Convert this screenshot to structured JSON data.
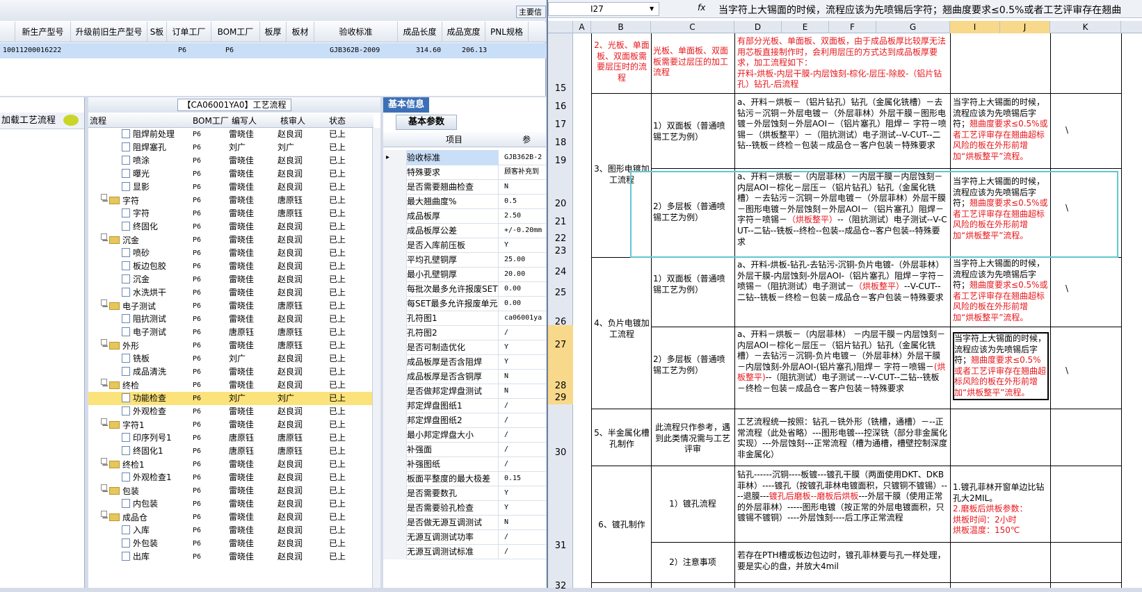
{
  "top_grid": {
    "main_button": "主要信",
    "headers": [
      "",
      "新生产型号",
      "升级前旧生产型号",
      "S板",
      "订单工厂",
      "BOM工厂",
      "板厚",
      "板材",
      "验收标准",
      "成品长度",
      "成品宽度",
      "PNL规格"
    ],
    "row": [
      "10011200016222",
      "",
      "P6",
      "P6",
      "",
      "",
      "GJB362B-2009",
      "314.60",
      "206.13",
      ""
    ]
  },
  "left_panel": {
    "label": "加载工艺流程"
  },
  "tree_panel": {
    "title": "【CA06001YA0】工艺流程",
    "headers": [
      "流程",
      "BOM工厂",
      "编写人",
      "核审人",
      "状态"
    ],
    "rows": [
      {
        "type": "item",
        "name": "阻焊前处理",
        "bom": "P6",
        "writer": "雷晓佳",
        "reviewer": "赵良润",
        "status": "已上"
      },
      {
        "type": "item",
        "name": "阻焊塞孔",
        "bom": "P6",
        "writer": "刘广",
        "reviewer": "刘广",
        "status": "已上"
      },
      {
        "type": "item",
        "name": "喷涂",
        "bom": "P6",
        "writer": "雷晓佳",
        "reviewer": "赵良润",
        "status": "已上"
      },
      {
        "type": "item",
        "name": "曝光",
        "bom": "P6",
        "writer": "雷晓佳",
        "reviewer": "赵良润",
        "status": "已上"
      },
      {
        "type": "item",
        "name": "显影",
        "bom": "P6",
        "writer": "雷晓佳",
        "reviewer": "赵良润",
        "status": "已上"
      },
      {
        "type": "folder",
        "name": "字符",
        "bom": "P6",
        "writer": "雷晓佳",
        "reviewer": "唐原钰",
        "status": "已上"
      },
      {
        "type": "item",
        "name": "字符",
        "bom": "P6",
        "writer": "雷晓佳",
        "reviewer": "唐原钰",
        "status": "已上"
      },
      {
        "type": "item",
        "name": "终固化",
        "bom": "P6",
        "writer": "雷晓佳",
        "reviewer": "赵良润",
        "status": "已上"
      },
      {
        "type": "folder",
        "name": "沉金",
        "bom": "P6",
        "writer": "雷晓佳",
        "reviewer": "赵良润",
        "status": "已上"
      },
      {
        "type": "item",
        "name": "喷砂",
        "bom": "P6",
        "writer": "雷晓佳",
        "reviewer": "赵良润",
        "status": "已上"
      },
      {
        "type": "item",
        "name": "板边包胶",
        "bom": "P6",
        "writer": "雷晓佳",
        "reviewer": "赵良润",
        "status": "已上"
      },
      {
        "type": "item",
        "name": "沉金",
        "bom": "P6",
        "writer": "雷晓佳",
        "reviewer": "赵良润",
        "status": "已上"
      },
      {
        "type": "item",
        "name": "水洗烘干",
        "bom": "P6",
        "writer": "雷晓佳",
        "reviewer": "赵良润",
        "status": "已上"
      },
      {
        "type": "folder",
        "name": "电子测试",
        "bom": "P6",
        "writer": "雷晓佳",
        "reviewer": "唐原钰",
        "status": "已上"
      },
      {
        "type": "item",
        "name": "阻抗测试",
        "bom": "P6",
        "writer": "雷晓佳",
        "reviewer": "赵良润",
        "status": "已上"
      },
      {
        "type": "item",
        "name": "电子测试",
        "bom": "P6",
        "writer": "唐原钰",
        "reviewer": "唐原钰",
        "status": "已上"
      },
      {
        "type": "folder",
        "name": "外形",
        "bom": "P6",
        "writer": "雷晓佳",
        "reviewer": "唐原钰",
        "status": "已上"
      },
      {
        "type": "item",
        "name": "铣板",
        "bom": "P6",
        "writer": "刘广",
        "reviewer": "赵良润",
        "status": "已上"
      },
      {
        "type": "item",
        "name": "成品清洗",
        "bom": "P6",
        "writer": "雷晓佳",
        "reviewer": "赵良润",
        "status": "已上"
      },
      {
        "type": "folder",
        "name": "终检",
        "bom": "P6",
        "writer": "雷晓佳",
        "reviewer": "赵良润",
        "status": "已上"
      },
      {
        "type": "item",
        "name": "功能检查",
        "bom": "P6",
        "writer": "刘广",
        "reviewer": "刘广",
        "status": "已上",
        "selected": true
      },
      {
        "type": "item",
        "name": "外观检查",
        "bom": "P6",
        "writer": "雷晓佳",
        "reviewer": "赵良润",
        "status": "已上"
      },
      {
        "type": "folder",
        "name": "字符1",
        "bom": "P6",
        "writer": "雷晓佳",
        "reviewer": "赵良润",
        "status": "已上"
      },
      {
        "type": "item",
        "name": "印序列号1",
        "bom": "P6",
        "writer": "唐原钰",
        "reviewer": "唐原钰",
        "status": "已上"
      },
      {
        "type": "item",
        "name": "终固化1",
        "bom": "P6",
        "writer": "唐原钰",
        "reviewer": "唐原钰",
        "status": "已上"
      },
      {
        "type": "folder",
        "name": "终检1",
        "bom": "P6",
        "writer": "雷晓佳",
        "reviewer": "赵良润",
        "status": "已上"
      },
      {
        "type": "item",
        "name": "外观检查1",
        "bom": "P6",
        "writer": "雷晓佳",
        "reviewer": "赵良润",
        "status": "已上"
      },
      {
        "type": "folder",
        "name": "包装",
        "bom": "P6",
        "writer": "雷晓佳",
        "reviewer": "赵良润",
        "status": "已上"
      },
      {
        "type": "item",
        "name": "内包装",
        "bom": "P6",
        "writer": "雷晓佳",
        "reviewer": "赵良润",
        "status": "已上"
      },
      {
        "type": "folder",
        "name": "成品仓",
        "bom": "P6",
        "writer": "雷晓佳",
        "reviewer": "赵良润",
        "status": "已上"
      },
      {
        "type": "item",
        "name": "入库",
        "bom": "P6",
        "writer": "雷晓佳",
        "reviewer": "赵良润",
        "status": "已上"
      },
      {
        "type": "item",
        "name": "外包装",
        "bom": "P6",
        "writer": "雷晓佳",
        "reviewer": "赵良润",
        "status": "已上"
      },
      {
        "type": "item",
        "name": "出库",
        "bom": "P6",
        "writer": "雷晓佳",
        "reviewer": "赵良润",
        "status": "已上"
      }
    ]
  },
  "prop_panel": {
    "tab": "基本信息",
    "subtab": "基本参数",
    "col_item": "项目",
    "col_value": "参",
    "rows": [
      {
        "name": "验收标准",
        "value": "GJB362B-2",
        "selected": true
      },
      {
        "name": "特殊要求",
        "value": "顾客补充到"
      },
      {
        "name": "是否需要翘曲检查",
        "value": "N"
      },
      {
        "name": "最大翘曲度%",
        "value": "0.5"
      },
      {
        "name": "成品板厚",
        "value": "2.50"
      },
      {
        "name": "成品板厚公差",
        "value": "+/-0.20mm"
      },
      {
        "name": "是否入库前压板",
        "value": "Y"
      },
      {
        "name": "平均孔壁铜厚",
        "value": "25.00"
      },
      {
        "name": "最小孔壁铜厚",
        "value": "20.00"
      },
      {
        "name": "每批次最多允许报废SET",
        "value": "0.00"
      },
      {
        "name": "每SET最多允许报废单元",
        "value": "0.00"
      },
      {
        "name": "孔符图1",
        "value": "ca06001ya"
      },
      {
        "name": "孔符图2",
        "value": "/"
      },
      {
        "name": "是否可制造优化",
        "value": "Y"
      },
      {
        "name": "成品板厚是否含阻焊",
        "value": "Y"
      },
      {
        "name": "成品板厚是否含铜厚",
        "value": "N"
      },
      {
        "name": "是否做邦定焊盘测试",
        "value": "N"
      },
      {
        "name": "邦定焊盘图纸1",
        "value": "/"
      },
      {
        "name": "邦定焊盘图纸2",
        "value": "/"
      },
      {
        "name": "最小邦定焊盘大小",
        "value": "/"
      },
      {
        "name": "补强面",
        "value": "/"
      },
      {
        "name": "补强图纸",
        "value": "/"
      },
      {
        "name": "板面平整度的最大极差",
        "value": "0.15"
      },
      {
        "name": "是否需要数孔",
        "value": "Y"
      },
      {
        "name": "是否需要验孔检查",
        "value": "Y"
      },
      {
        "name": "是否做无源互调测试",
        "value": "N"
      },
      {
        "name": "无源互调测试功率",
        "value": "/"
      },
      {
        "name": "无源互调测试标准",
        "value": "/"
      }
    ]
  },
  "excel": {
    "name_box": "I27",
    "fx": "fx",
    "formula": "当字符上大锡面的时候，流程应该为先喷锡后字符；翘曲度要求≤0.5%或者工艺评审存在翘曲",
    "columns": [
      "A",
      "B",
      "C",
      "D",
      "E",
      "F",
      "G",
      "I",
      "J",
      "K"
    ],
    "row_numbers": [
      "15",
      "16",
      "17",
      "18",
      "19",
      "20",
      "21",
      "22",
      "23",
      "24",
      "25",
      "26",
      "27",
      "28",
      "29",
      "30",
      "31",
      "32"
    ],
    "rows": {
      "r15_b": "2、光板、单面板、双面板需要层压时的流程",
      "r15_c": "光板、单面板、双面板需要过层压的加工流程",
      "r15_d": "有部分光板、单面板、双面板，由于成品板厚比较厚无法用芯板直接制作时，会利用层压的方式达到成品板厚要求，加工流程如下：\n开料-烘板-内层干膜-内层蚀刻-棕化-层压-除胶-（铝片钻孔）钻孔-后流程",
      "sec3": "3、图形电镀加工流程",
      "r16_c": "1）双面板（普通喷锡工艺为例）",
      "r16_d": "a、开料－烘板－（铝片钻孔）钻孔（金属化铣槽）－去钻污－沉铜－外层电镀－（外层菲林）外层干膜－图形电镀－外层蚀刻－外层AOI－（铝片塞孔）阻焊－ 字符－喷锡－（烘板整平）－（阻抗测试）电子测试--V-CUT--二钻--铣板－终检－包装－成品仓－客户包装－特殊要求",
      "note_black": "当字符上大锡面的时候，流程应该为先喷锡后字符；",
      "note_red": "翘曲度要求≤0.5%或者工艺评审存在翘曲超标风险的板在外形前增加“烘板整平”流程。",
      "backslash": "\\",
      "r20_c": "2）多层板（普通喷锡工艺为例）",
      "r20_d1": "a、开料－烘板－（内层菲林）－内层干膜－内层蚀刻－内层AOI－棕化－层压－（铝片钻孔）钻孔（金属化铣槽）－去钻污－沉铜－外层电镀－（外层菲林）外层干膜－图形电镀－外层蚀刻－外层AOI－（铝片塞孔）阻焊－ 字符－喷锡－",
      "r20_d2": "（烘板整平）",
      "r20_d3": "--（阻抗测试）电子测试--V-CUT--二钻--铣板--终检--包装--成品仓--客户包装--特殊要求",
      "sec4": "4、负片电镀加工流程",
      "r24_c": "1）双面板（普通喷锡工艺为例）",
      "r24_d1": "a、开料-烘板-钻孔-去钻污-沉铜-负片电镀-（外层菲林）外层干膜-内层蚀刻-外层AOI-（铝片塞孔）阻焊－字符－喷锡－（阻抗测试）电子测试－",
      "r24_d2": "（烘板整平）",
      "r24_d3": "--V-CUT--二钻--铣板－终检－包装－成品仓－客户包装－特殊要求",
      "r27_c": "2）多层板（普通喷锡工艺为例）",
      "r27_d1": "a、开料－烘板－（内层菲林） －内层干膜－内层蚀刻－内层AOI－棕化－层压－（铝片钻孔）钻孔（金属化铣槽）－去钻污－沉铜-负片电镀－（外层菲林）外层干膜－内层蚀刻-外层AOI-(铝片塞孔)阻焊－ 字符－喷锡－",
      "r27_d2": "(烘板整平)",
      "r27_d3": "--（阻抗测试）电子测试－--V-CUT--二钻--铣板－终检－包装－成品仓－客户包装－特殊要求",
      "sec5": "5、半金属化槽孔制作",
      "r30_c": "此流程只作参考，遇到此类情况需与工艺评审",
      "r30_d": "工艺流程统一按照：钻孔－铣外形（铣槽，通槽）－--正常流程（此处省略）---图形电镀---控深铣（部分非金属化实现）---外层蚀刻---正常流程（槽为通槽，槽壁控制深度非金属化）",
      "sec6": "6、镀孔制作",
      "r31_c": "1）镀孔流程",
      "r31_d1": "钻孔------沉铜----板镀---镀孔干膜（两面使用DKT、DKB菲林）----镀孔（按镀孔菲林电镀面积，只镀铜不镀锡）----退膜---",
      "r31_d2": "镀孔后磨板--磨板后烘板",
      "r31_d3": "---外层干膜（使用正常的外层菲林）-----图形电镀（按正常的外层电镀面积，只镀锡不镀铜）----外层蚀刻----后工序正常流程",
      "r31_i1": "1.镀孔菲林开窗单边比钻孔大2MIL。",
      "r31_i2": "2.磨板后烘板参数：\n烘板时间：2小时\n烘板温度：150℃",
      "r32_c": "2）注意事项",
      "r32_d": "若存在PTH槽或板边包边时，镀孔菲林要与孔一样处理，要是实心的盘，并放大4mil"
    }
  },
  "colors": {
    "red_text": "#e8161b",
    "selection_cyan": "#5fc8cf",
    "tree_selected": "#fbe27a",
    "header_blue": "#3d6fb6"
  }
}
